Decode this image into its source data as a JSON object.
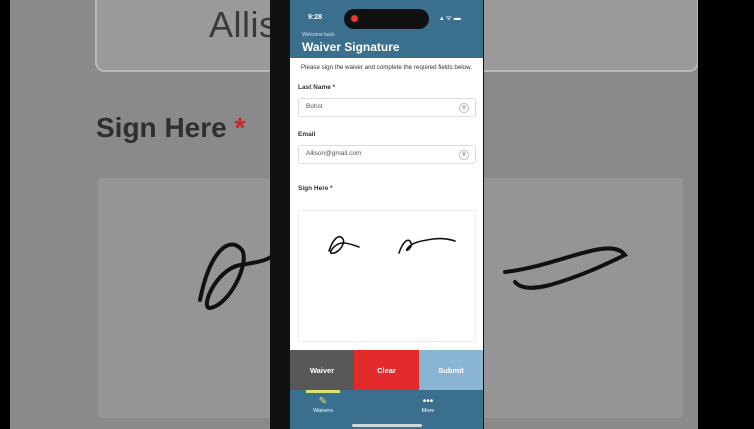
{
  "background": {
    "email_value": "Allison@gn",
    "sign_label": "Sign Here",
    "sign_required": "*"
  },
  "status_bar": {
    "time": "9:28",
    "icons": "▴ ᯤ ▬"
  },
  "header": {
    "subtitle": "Welcome back",
    "title": "Waiver Signature"
  },
  "form": {
    "intro": "Please sign the waiver and complete the required fields below.",
    "last_name_label": "Last Name *",
    "last_name_value": "Bohst",
    "email_label": "Email",
    "email_value": "Allison@gmail.com",
    "sign_label": "Sign Here *",
    "clear_icon": "⊗"
  },
  "actions": {
    "waiver": "Waiver",
    "clear": "Clear",
    "submit": "Submit"
  },
  "tabbar": {
    "waivers_label": "Waivers",
    "waivers_icon": "✎",
    "more_label": "More",
    "more_icon": "•••"
  },
  "colors": {
    "brand": "#3a6f8e",
    "clear": "#e32b2b",
    "submit": "#8ab5d2",
    "waiver": "#585858",
    "tab_accent": "#d9e36e"
  }
}
